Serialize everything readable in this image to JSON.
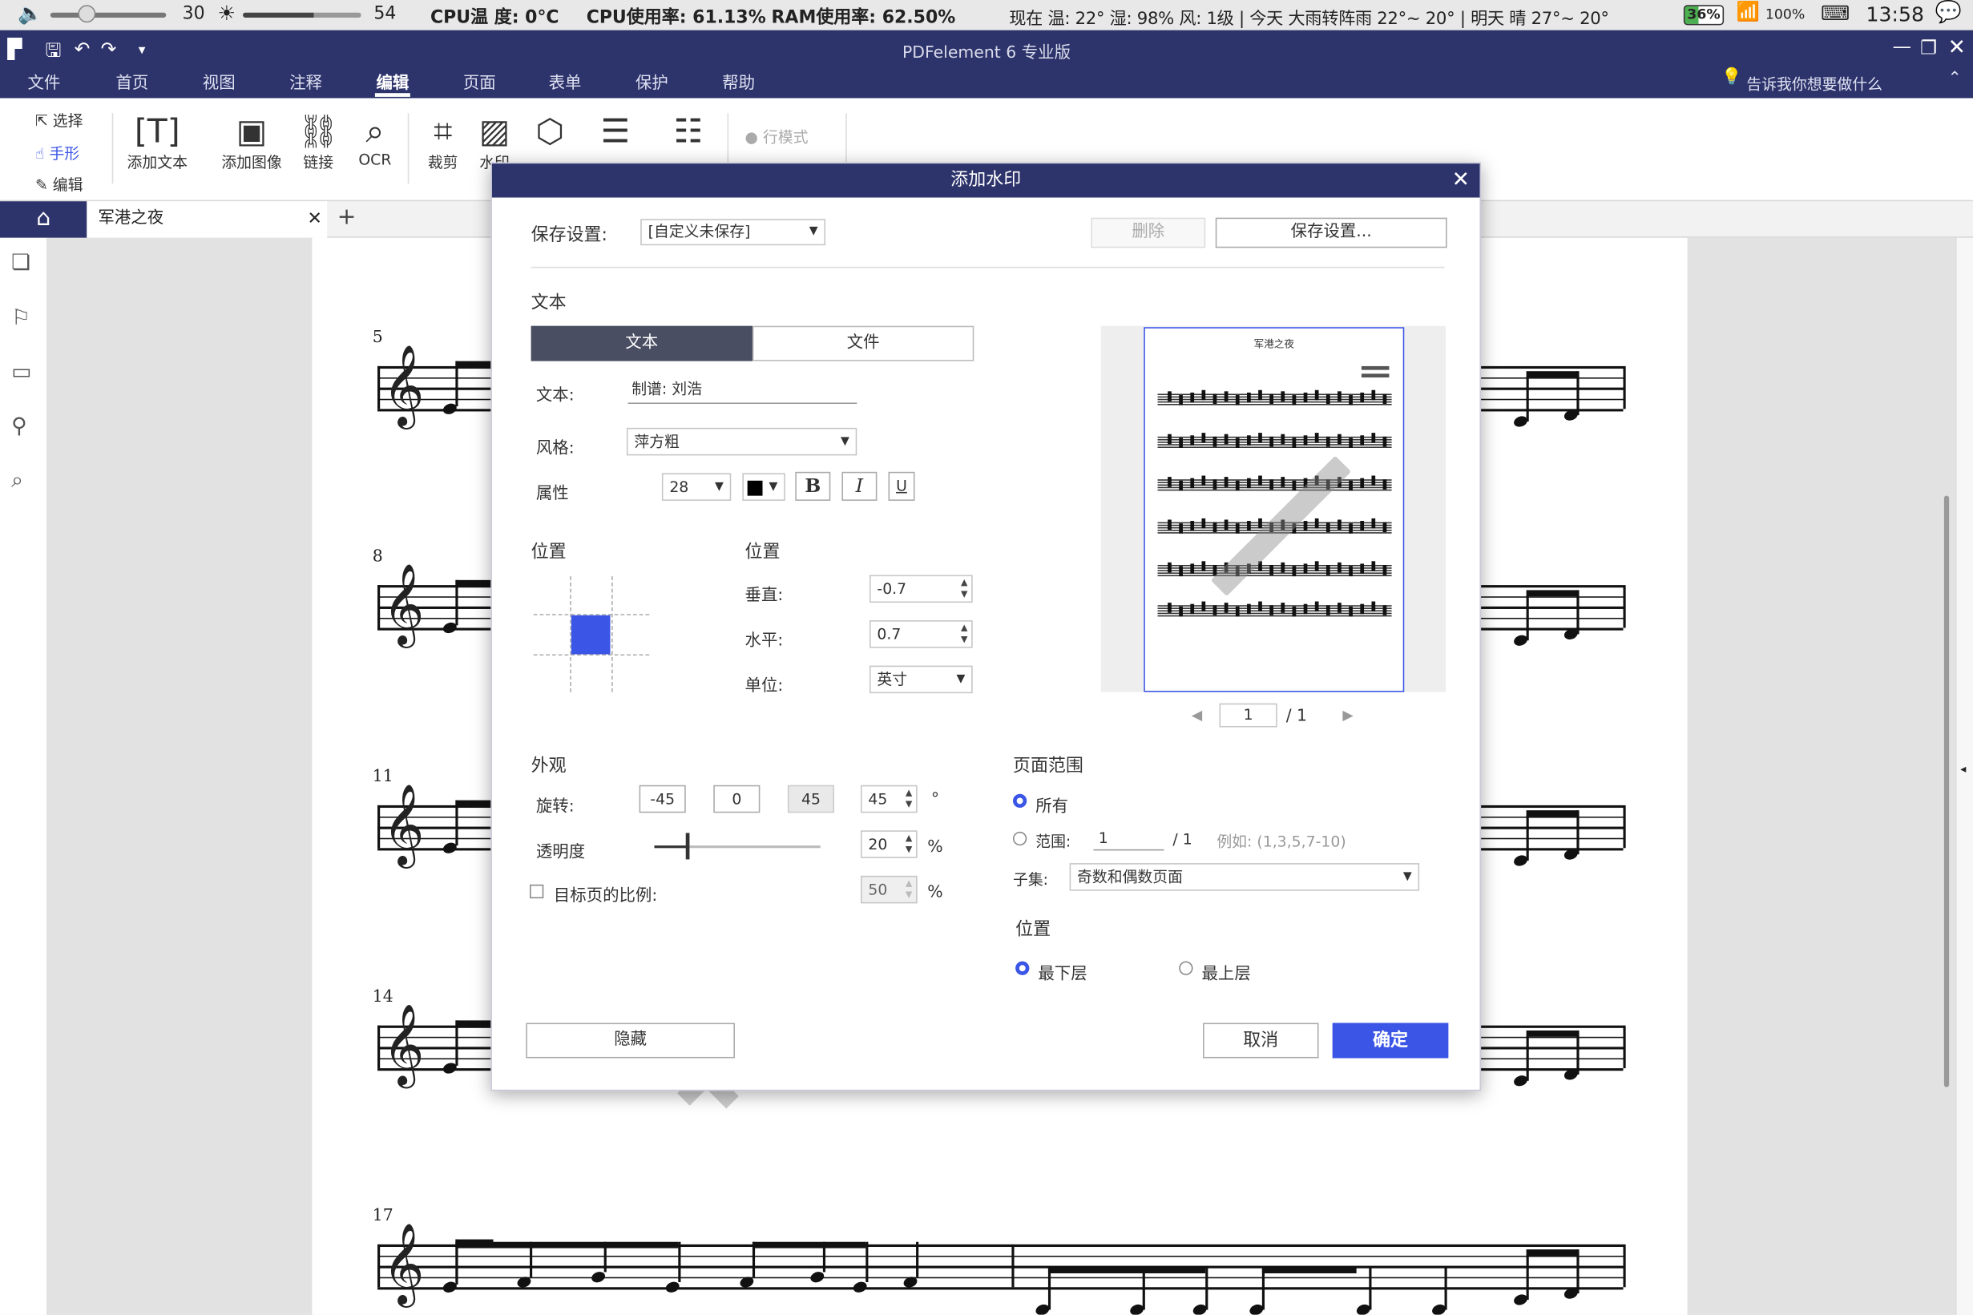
{
  "system_bar": {
    "volume": "30",
    "brightness": "54",
    "cpu_temp_label": "CPU温 度: 0°C",
    "cpu_usage": "CPU使用率: 61.13%",
    "ram_usage": "RAM使用率: 62.50%",
    "weather": "现在 温: 22° 湿: 98% 风: 1级 | 今天 大雨转阵雨 22°~ 20° | 明天 晴 27°~ 20°",
    "battery": "36%",
    "wifi": "100%",
    "time": "13:58"
  },
  "app": {
    "title": "PDFelement 6 专业版",
    "menu": [
      "文件",
      "首页",
      "视图",
      "注释",
      "编辑",
      "页面",
      "表单",
      "保护",
      "帮助"
    ],
    "active_menu": "编辑",
    "search_hint": "告诉我你想要做什么"
  },
  "ribbon": {
    "modes": [
      "选择",
      "手形",
      "编辑"
    ],
    "tools": [
      "添加文本",
      "添加图像",
      "链接",
      "OCR",
      "裁剪",
      "水印"
    ],
    "line_mode": "行模式"
  },
  "tabs": {
    "doc_name": "军港之夜"
  },
  "score": {
    "measure_numbers": [
      "5",
      "8",
      "11",
      "14",
      "17"
    ]
  },
  "dialog": {
    "title": "添加水印",
    "save_settings_label": "保存设置:",
    "save_settings_value": "[自定义未保存]",
    "delete_button": "删除",
    "save_button": "保存设置...",
    "text_section": "文本",
    "tab_text": "文本",
    "tab_file": "文件",
    "text_label": "文本:",
    "text_value": "制谱: 刘浩",
    "style_label": "风格:",
    "font_value": "萍方粗",
    "attr_label": "属性",
    "font_size": "28",
    "bold": "B",
    "italic": "I",
    "underline": "U",
    "position_section": "位置",
    "position_section2": "位置",
    "vertical_label": "垂直:",
    "vertical_value": "-0.7",
    "horizontal_label": "水平:",
    "horizontal_value": "0.7",
    "unit_label": "单位:",
    "unit_value": "英寸",
    "preview_title": "军港之夜",
    "preview_page": "1",
    "preview_total": "/ 1",
    "appearance_section": "外观",
    "rotate_label": "旋转:",
    "rotate_presets": [
      "-45",
      "0",
      "45"
    ],
    "rotate_value": "45",
    "degree": "°",
    "opacity_label": "透明度",
    "opacity_value": "20",
    "opacity_fraction": 0.2,
    "percent": "%",
    "scale_label": "目标页的比例:",
    "scale_value": "50",
    "page_range_section": "页面范围",
    "all_label": "所有",
    "range_label": "范围:",
    "range_value": "1",
    "range_total": "/ 1",
    "range_example": "例如: (1,3,5,7-10)",
    "subset_label": "子集:",
    "subset_value": "奇数和偶数页面",
    "layer_section": "位置",
    "bottom_layer": "最下层",
    "top_layer": "最上层",
    "hide_button": "隐藏",
    "cancel_button": "取消",
    "ok_button": "确定"
  }
}
